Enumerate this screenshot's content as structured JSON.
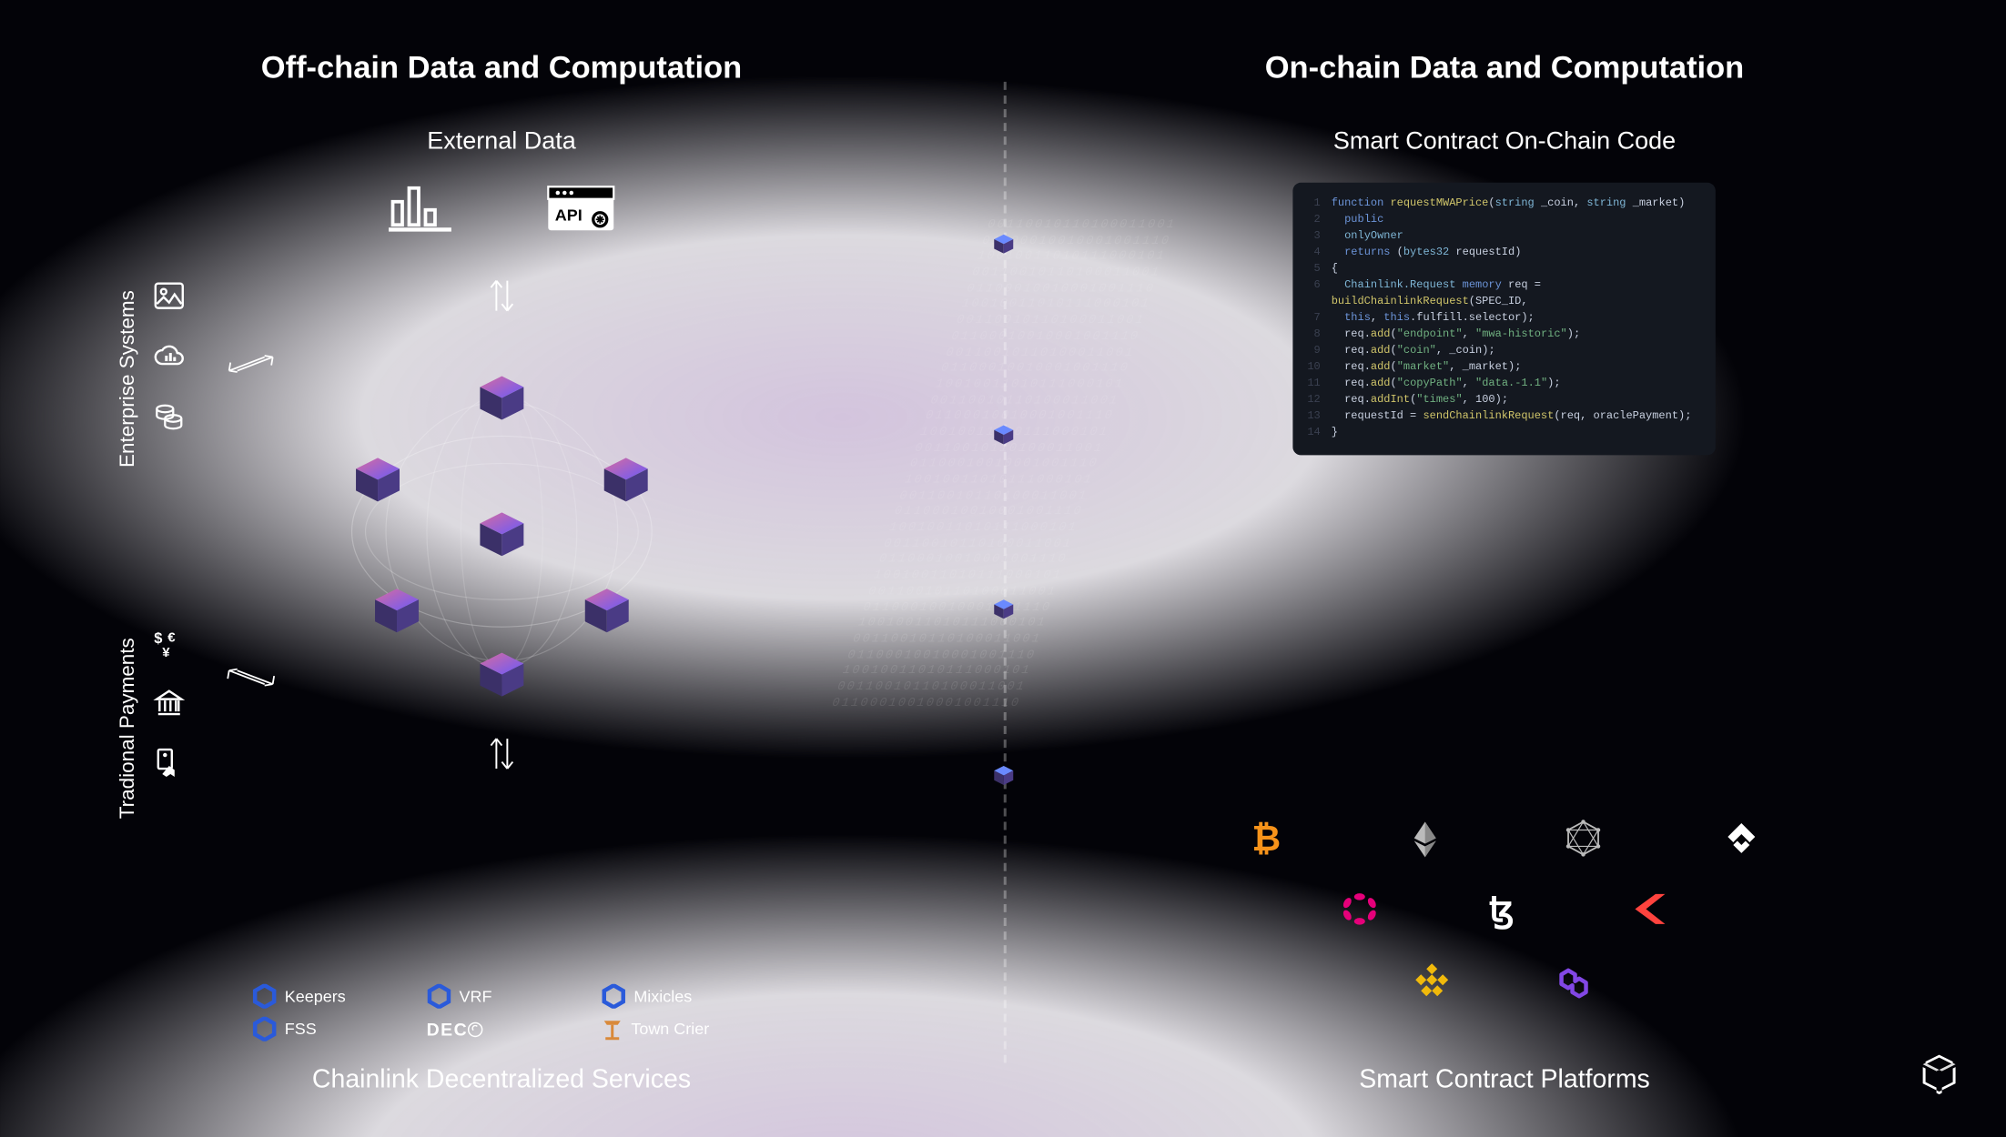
{
  "left": {
    "title": "Off-chain Data and Computation",
    "subtitle": "External Data",
    "bottom_label": "Chainlink Decentralized Services",
    "side_groups": [
      {
        "label": "Enterprise Systems",
        "icons": [
          "image-icon",
          "cloud-chart-icon",
          "database-icon"
        ]
      },
      {
        "label": "Tradional Payments",
        "icons": [
          "currency-icon",
          "bank-icon",
          "pay-icon"
        ]
      }
    ],
    "services": [
      {
        "name": "Keepers",
        "icon": "hex"
      },
      {
        "name": "VRF",
        "icon": "hex"
      },
      {
        "name": "Mixicles",
        "icon": "hex"
      },
      {
        "name": "FSS",
        "icon": "hex"
      },
      {
        "name": "DECO",
        "icon": "deco"
      },
      {
        "name": "Town Crier",
        "icon": "tc"
      }
    ]
  },
  "right": {
    "title": "On-chain Data and Computation",
    "subtitle": "Smart Contract On-Chain Code",
    "bottom_label": "Smart Contract Platforms",
    "code_lines": [
      {
        "num": "1",
        "html": "<span class='kw'>function</span> <span class='fn'>requestMWAPrice</span>(<span class='typ'>string</span> <span class='var'>_coin</span>, <span class='typ'>string</span> <span class='var'>_market</span>)"
      },
      {
        "num": "2",
        "html": "&nbsp;&nbsp;<span class='kw'>public</span>"
      },
      {
        "num": "3",
        "html": "&nbsp;&nbsp;<span class='typ'>onlyOwner</span>"
      },
      {
        "num": "4",
        "html": "&nbsp;&nbsp;<span class='kw'>returns</span> (<span class='typ'>bytes32</span> <span class='var'>requestId</span>)"
      },
      {
        "num": "5",
        "html": "{"
      },
      {
        "num": "6",
        "html": "&nbsp;&nbsp;<span class='typ'>Chainlink.Request</span> <span class='kw'>memory</span> <span class='var'>req</span> = <span class='fn'>buildChainlinkRequest</span>(SPEC_ID,"
      },
      {
        "num": "7",
        "html": "&nbsp;&nbsp;<span class='kw'>this</span>, <span class='kw'>this</span>.<span class='var'>fulfill.selector</span>);"
      },
      {
        "num": "8",
        "html": "&nbsp;&nbsp;<span class='var'>req</span>.<span class='fn'>add</span>(<span class='str'>\"endpoint\"</span>, <span class='str'>\"mwa-historic\"</span>);"
      },
      {
        "num": "9",
        "html": "&nbsp;&nbsp;<span class='var'>req</span>.<span class='fn'>add</span>(<span class='str'>\"coin\"</span>, <span class='var'>_coin</span>);"
      },
      {
        "num": "10",
        "html": "&nbsp;&nbsp;<span class='var'>req</span>.<span class='fn'>add</span>(<span class='str'>\"market\"</span>, <span class='var'>_market</span>);"
      },
      {
        "num": "11",
        "html": "&nbsp;&nbsp;<span class='var'>req</span>.<span class='fn'>add</span>(<span class='str'>\"copyPath\"</span>, <span class='str'>\"data.-1.1\"</span>);"
      },
      {
        "num": "12",
        "html": "&nbsp;&nbsp;<span class='var'>req</span>.<span class='fn'>addInt</span>(<span class='str'>\"times\"</span>, <span class='var'>100</span>);"
      },
      {
        "num": "13",
        "html": "&nbsp;&nbsp;<span class='var'>requestId</span> = <span class='fn'>sendChainlinkRequest</span>(<span class='var'>req</span>, <span class='var'>oraclePayment</span>);"
      },
      {
        "num": "14",
        "html": "}"
      }
    ],
    "platforms": [
      [
        "bitcoin",
        "ethereum",
        "hyperledger",
        "conflux"
      ],
      [
        "polkadot",
        "tezos",
        "kava"
      ],
      [
        "binance",
        "polygon"
      ]
    ]
  },
  "binary_text": "00110010110100011001\n01100010010001001110\n10010011010111000101\n00110010110100011001\n01100010010001001110\n10010011010111000101\n00110010110100011001\n01100010010001001110\n00110010110100011001\n01100010010001001110\n10010011010111000101\n00110010110100011001\n01100010010001001110\n10010011010111000101\n00110010110100011001\n01100010010001001110\n10010011010111000101\n00110010110100011001\n01100010010001001110\n10010011010111000101\n00110010110100011001\n01100010010001001110\n10010011010111000101\n00110010110100011001\n01100010010001001110\n10010011010111000101\n00110010110100011001\n01100010010001001110\n10010011010111000101\n00110010110100011001\n01100010010001001110"
}
